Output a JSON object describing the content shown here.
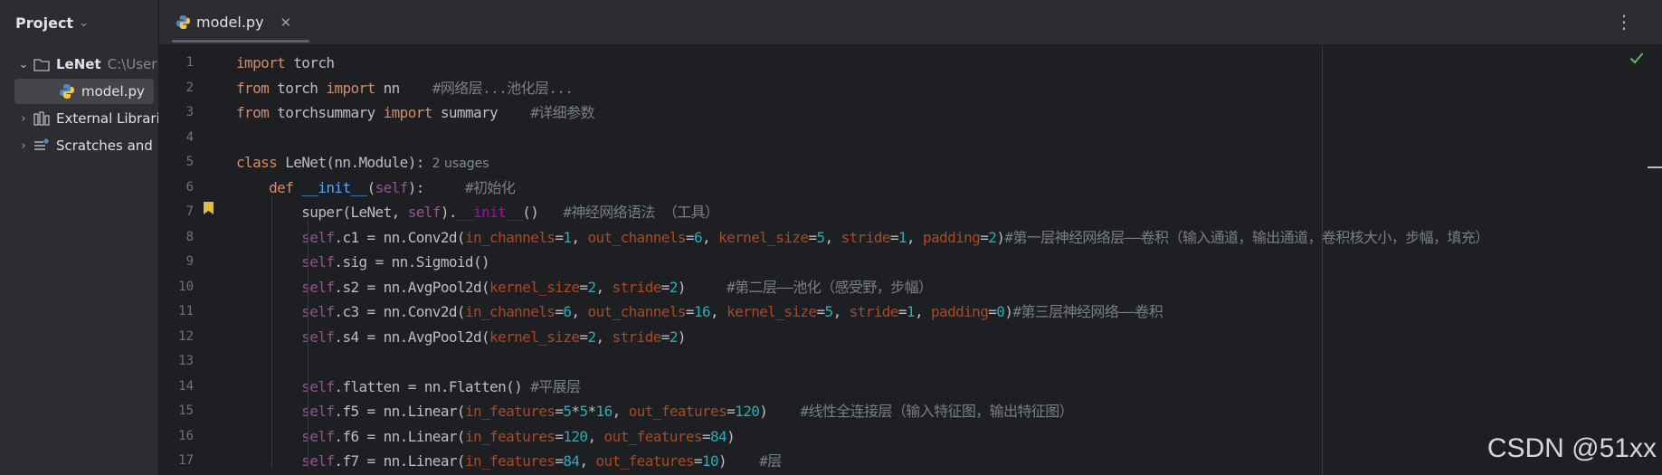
{
  "sidebar": {
    "title": "Project",
    "items": [
      {
        "label": "LeNet",
        "path": "C:\\User"
      },
      {
        "label": "model.py"
      },
      {
        "label": "External Librari"
      },
      {
        "label": "Scratches and"
      }
    ]
  },
  "tabs": [
    {
      "label": "model.py"
    }
  ],
  "editor": {
    "line_numbers": [
      "1",
      "2",
      "3",
      "4",
      "5",
      "6",
      "7",
      "8",
      "9",
      "10",
      "11",
      "12",
      "13",
      "14",
      "15",
      "16",
      "17"
    ],
    "usages_hint": "2 usages",
    "code": {
      "l1": [
        [
          "import",
          "kw"
        ],
        [
          " torch",
          "id"
        ]
      ],
      "l2": [
        [
          "from",
          "kw"
        ],
        [
          " torch ",
          "id"
        ],
        [
          "import",
          "kw"
        ],
        [
          " nn    ",
          "id"
        ],
        [
          "#网络层...池化层...",
          "cm"
        ]
      ],
      "l3": [
        [
          "from",
          "kw"
        ],
        [
          " torchsummary ",
          "id"
        ],
        [
          "import",
          "kw"
        ],
        [
          " summary    ",
          "id"
        ],
        [
          "#详细参数",
          "cm"
        ]
      ],
      "l4": [],
      "l5": [
        [
          "class",
          "kw"
        ],
        [
          " LeNet(nn.Module):",
          "id"
        ]
      ],
      "l6": [
        [
          "    ",
          "id"
        ],
        [
          "def",
          "kw"
        ],
        [
          " ",
          "id"
        ],
        [
          "__init__",
          "fn"
        ],
        [
          "(",
          "id"
        ],
        [
          "self",
          "self"
        ],
        [
          "):     ",
          "id"
        ],
        [
          "#初始化",
          "cm"
        ]
      ],
      "l7": [
        [
          "        super(LeNet, ",
          "id"
        ],
        [
          "self",
          "self"
        ],
        [
          ").",
          "id"
        ],
        [
          "__init__",
          "dunder"
        ],
        [
          "()   ",
          "id"
        ],
        [
          "#神经网络语法 （工具）",
          "cm"
        ]
      ],
      "l8": [
        [
          "        ",
          "id"
        ],
        [
          "self",
          "self"
        ],
        [
          ".c1 = nn.Conv2d(",
          "id"
        ],
        [
          "in_channels",
          "np"
        ],
        [
          "=",
          "id"
        ],
        [
          "1",
          "num"
        ],
        [
          ", ",
          "id"
        ],
        [
          "out_channels",
          "np"
        ],
        [
          "=",
          "id"
        ],
        [
          "6",
          "num"
        ],
        [
          ", ",
          "id"
        ],
        [
          "kernel_size",
          "np"
        ],
        [
          "=",
          "id"
        ],
        [
          "5",
          "num"
        ],
        [
          ", ",
          "id"
        ],
        [
          "stride",
          "np"
        ],
        [
          "=",
          "id"
        ],
        [
          "1",
          "num"
        ],
        [
          ", ",
          "id"
        ],
        [
          "padding",
          "np"
        ],
        [
          "=",
          "id"
        ],
        [
          "2",
          "num"
        ],
        [
          ")",
          "id"
        ],
        [
          "#第一层神经网络层——卷积（输入通道，输出通道，卷积核大小，步幅，填充）",
          "cm"
        ]
      ],
      "l9": [
        [
          "        ",
          "id"
        ],
        [
          "self",
          "self"
        ],
        [
          ".sig = nn.Sigmoid()",
          "id"
        ]
      ],
      "l10": [
        [
          "        ",
          "id"
        ],
        [
          "self",
          "self"
        ],
        [
          ".s2 = nn.AvgPool2d(",
          "id"
        ],
        [
          "kernel_size",
          "np"
        ],
        [
          "=",
          "id"
        ],
        [
          "2",
          "num"
        ],
        [
          ", ",
          "id"
        ],
        [
          "stride",
          "np"
        ],
        [
          "=",
          "id"
        ],
        [
          "2",
          "num"
        ],
        [
          ")     ",
          "id"
        ],
        [
          "#第二层——池化（感受野，步幅）",
          "cm"
        ]
      ],
      "l11": [
        [
          "        ",
          "id"
        ],
        [
          "self",
          "self"
        ],
        [
          ".c3 = nn.Conv2d(",
          "id"
        ],
        [
          "in_channels",
          "np"
        ],
        [
          "=",
          "id"
        ],
        [
          "6",
          "num"
        ],
        [
          ", ",
          "id"
        ],
        [
          "out_channels",
          "np"
        ],
        [
          "=",
          "id"
        ],
        [
          "16",
          "num"
        ],
        [
          ", ",
          "id"
        ],
        [
          "kernel_size",
          "np"
        ],
        [
          "=",
          "id"
        ],
        [
          "5",
          "num"
        ],
        [
          ", ",
          "id"
        ],
        [
          "stride",
          "np"
        ],
        [
          "=",
          "id"
        ],
        [
          "1",
          "num"
        ],
        [
          ", ",
          "id"
        ],
        [
          "padding",
          "np"
        ],
        [
          "=",
          "id"
        ],
        [
          "0",
          "num"
        ],
        [
          ")",
          "id"
        ],
        [
          "#第三层神经网络——卷积",
          "cm"
        ]
      ],
      "l12": [
        [
          "        ",
          "id"
        ],
        [
          "self",
          "self"
        ],
        [
          ".s4 = nn.AvgPool2d(",
          "id"
        ],
        [
          "kernel_size",
          "np"
        ],
        [
          "=",
          "id"
        ],
        [
          "2",
          "num"
        ],
        [
          ", ",
          "id"
        ],
        [
          "stride",
          "np"
        ],
        [
          "=",
          "id"
        ],
        [
          "2",
          "num"
        ],
        [
          ")",
          "id"
        ]
      ],
      "l13": [],
      "l14": [
        [
          "        ",
          "id"
        ],
        [
          "self",
          "self"
        ],
        [
          ".flatten = nn.Flatten() ",
          "id"
        ],
        [
          "#平展层",
          "cm"
        ]
      ],
      "l15": [
        [
          "        ",
          "id"
        ],
        [
          "self",
          "self"
        ],
        [
          ".f5 = nn.Linear(",
          "id"
        ],
        [
          "in_features",
          "np"
        ],
        [
          "=",
          "id"
        ],
        [
          "5",
          "num"
        ],
        [
          "*",
          "id"
        ],
        [
          "5",
          "num"
        ],
        [
          "*",
          "id"
        ],
        [
          "16",
          "num"
        ],
        [
          ", ",
          "id"
        ],
        [
          "out_features",
          "np"
        ],
        [
          "=",
          "id"
        ],
        [
          "120",
          "num"
        ],
        [
          ")    ",
          "id"
        ],
        [
          "#线性全连接层（输入特征图，输出特征图）",
          "cm"
        ]
      ],
      "l16": [
        [
          "        ",
          "id"
        ],
        [
          "self",
          "self"
        ],
        [
          ".f6 = nn.Linear(",
          "id"
        ],
        [
          "in_features",
          "np"
        ],
        [
          "=",
          "id"
        ],
        [
          "120",
          "num"
        ],
        [
          ", ",
          "id"
        ],
        [
          "out_features",
          "np"
        ],
        [
          "=",
          "id"
        ],
        [
          "84",
          "num"
        ],
        [
          ")",
          "id"
        ]
      ],
      "l17": [
        [
          "        ",
          "id"
        ],
        [
          "self",
          "self"
        ],
        [
          ".f7 = nn.Linear(",
          "id"
        ],
        [
          "in_features",
          "np"
        ],
        [
          "=",
          "id"
        ],
        [
          "84",
          "num"
        ],
        [
          ", ",
          "id"
        ],
        [
          "out_features",
          "np"
        ],
        [
          "=",
          "id"
        ],
        [
          "10",
          "num"
        ],
        [
          ")    ",
          "id"
        ],
        [
          "#层",
          "cm"
        ]
      ]
    }
  },
  "watermark": "CSDN @51xx",
  "colors": {
    "keyword": "#cf8e6d",
    "comment": "#7a7e85",
    "self": "#94558d",
    "named_param": "#aa4926",
    "number": "#2aacb8",
    "function": "#56a8f5",
    "dunder": "#b200b2"
  },
  "icons": [
    "chevron-down-icon",
    "folder-icon",
    "python-file-icon",
    "chevron-right-icon",
    "library-icon",
    "scratches-icon",
    "close-icon",
    "more-vertical-icon",
    "bookmark-icon",
    "check-icon"
  ]
}
